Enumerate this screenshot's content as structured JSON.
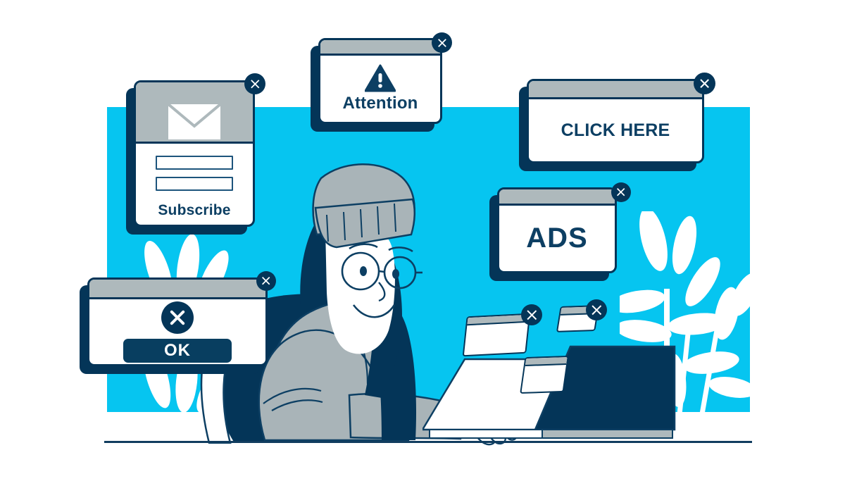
{
  "scene": {
    "title": "Pop-up ads overwhelming a person at a laptop",
    "colors": {
      "cyan_background": "#06c5f0",
      "navy": "#043558",
      "titlebar_gray": "#aeb9bc",
      "white": "#ffffff",
      "skin_white": "#ffffff",
      "hoodie_gray": "#a9b4b8",
      "line_navy": "#0d3f63"
    }
  },
  "popups": [
    {
      "id": "subscribe",
      "title": "Subscribe",
      "icon": "envelope-icon",
      "close_icon": "close-x-icon",
      "fields": [
        {
          "name": "field-1",
          "value": "",
          "placeholder": ""
        },
        {
          "name": "field-2",
          "value": "",
          "placeholder": ""
        }
      ]
    },
    {
      "id": "attention",
      "title": "Attention",
      "icon": "warning-triangle-icon",
      "close_icon": "close-x-icon"
    },
    {
      "id": "click-here",
      "title": "CLICK HERE",
      "close_icon": "close-x-icon"
    },
    {
      "id": "ads",
      "title": "ADS",
      "close_icon": "close-x-icon"
    },
    {
      "id": "ok",
      "title": "OK",
      "icon": "error-x-circle-icon",
      "close_icon": "close-x-icon",
      "button_label": "OK"
    }
  ],
  "mini_windows": [
    {
      "id": "mini-1",
      "close_icon": "close-x-icon"
    },
    {
      "id": "mini-2",
      "close_icon": "close-x-icon"
    },
    {
      "id": "mini-3",
      "close_icon": ""
    }
  ],
  "figure": {
    "name": "person-at-laptop",
    "wears": [
      "beanie-hat",
      "round-glasses",
      "hoodie"
    ],
    "device": "laptop"
  },
  "decor": {
    "plant_right": "potted-plant",
    "plant_left": "leaf-cluster",
    "floor_line": "desk-edge-line"
  }
}
